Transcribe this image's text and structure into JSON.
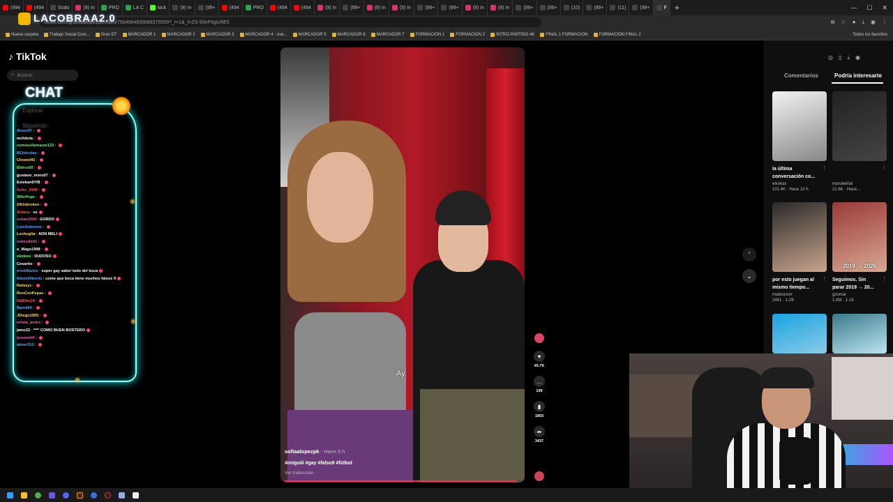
{
  "browser": {
    "tabs": [
      {
        "label": "(494",
        "color": "#ff0000"
      },
      {
        "label": "(494",
        "color": "#ff0000"
      },
      {
        "label": "Sodo",
        "color": "#444444"
      },
      {
        "label": "(9) In",
        "color": "#e1306c"
      },
      {
        "label": "PRO",
        "color": "#2aa44f"
      },
      {
        "label": "LA C",
        "color": "#2aa44f"
      },
      {
        "label": "kick",
        "color": "#53fc18"
      },
      {
        "label": "(9) In",
        "color": "#444444"
      },
      {
        "label": "(99+",
        "color": "#444444"
      },
      {
        "label": "(494",
        "color": "#ff0000"
      },
      {
        "label": "PRO",
        "color": "#2aa44f"
      },
      {
        "label": "(494",
        "color": "#ff0000"
      },
      {
        "label": "(494",
        "color": "#ff0000"
      },
      {
        "label": "(9) In",
        "color": "#e1306c"
      },
      {
        "label": "(99+",
        "color": "#444444"
      },
      {
        "label": "(9) In",
        "color": "#e1306c"
      },
      {
        "label": "(9) In",
        "color": "#e1306c"
      },
      {
        "label": "(99+",
        "color": "#444444"
      },
      {
        "label": "(99+",
        "color": "#444444"
      },
      {
        "label": "(9) In",
        "color": "#e1306c"
      },
      {
        "label": "(9) In",
        "color": "#e1306c"
      },
      {
        "label": "(99+",
        "color": "#444444"
      },
      {
        "label": "(99+",
        "color": "#444444"
      },
      {
        "label": "(10)",
        "color": "#444444"
      },
      {
        "label": "(99+",
        "color": "#444444"
      },
      {
        "label": "(11)",
        "color": "#444444"
      },
      {
        "label": "(99+",
        "color": "#444444"
      },
      {
        "label": "F",
        "color": "#444444",
        "active": true
      }
    ],
    "new_tab": "+",
    "url": "tiktok.com/@sofiaalopezpk/video/7604964935688375559?_r=1&_t=ZS-93nF5gIcRE5",
    "bookmarks": [
      "Nueva carpeta",
      "Trabajo Social Com...",
      "Gran DT",
      "MARCADOR 1",
      "MARCADOR 2",
      "MARCADOR 3",
      "MARCADOR 4 - ove...",
      "MARCADOR 5",
      "MARCADOR 6",
      "MARCADOR 7",
      "FORMACION 1",
      "FORMACION 2",
      "INTRO PARTIDO 4K",
      "FINAL 1 FORMACION",
      "FORMACION FINAL 2"
    ],
    "favorites_label": "Todos los favoritos"
  },
  "overlay": {
    "logo": "LACOBRAA2.0",
    "chat_title": "CHAT"
  },
  "sidebar": {
    "brand": "TikTok",
    "search_placeholder": "Buscar",
    "faded_items": [
      "Explorar",
      "Siguiendo"
    ]
  },
  "chat": {
    "messages": [
      {
        "user": "Alono07",
        "text": "",
        "color": "#55aaff"
      },
      {
        "user": "mchitula",
        "text": "",
        "color": "#ffffff"
      },
      {
        "user": "comosellamaute123",
        "text": "",
        "color": "#66ff66"
      },
      {
        "user": "853nicolas",
        "text": "",
        "color": "#55aaff"
      },
      {
        "user": "Chowel45",
        "text": "",
        "color": "#ffdd55"
      },
      {
        "user": "Eldrss00",
        "text": "",
        "color": "#66ff66"
      },
      {
        "user": "gustavo_moru07",
        "text": "",
        "color": "#ffffff"
      },
      {
        "user": "EstebanDVB",
        "text": "",
        "color": "#ffffff"
      },
      {
        "user": "Ssfer_2008",
        "text": "",
        "color": "#ff5555"
      },
      {
        "user": "SlferPope",
        "text": "",
        "color": "#66ff66"
      },
      {
        "user": "24Unbroken",
        "text": "",
        "color": "#ffdd55"
      },
      {
        "user": "Aldana",
        "text": "ee",
        "color": "#ff5555"
      },
      {
        "user": "sebas2004",
        "text": "GORDO",
        "color": "#ff55aa"
      },
      {
        "user": "LuisGutierrez",
        "text": "",
        "color": "#55aaff"
      },
      {
        "user": "Lechugita",
        "text": "ADN MELI",
        "color": "#ffdd55"
      },
      {
        "user": "sebexddd1",
        "text": "",
        "color": "#ff55aa"
      },
      {
        "user": "o_Mago1998",
        "text": "",
        "color": "#ffffff"
      },
      {
        "user": "okekesi",
        "text": "DUDOSO",
        "color": "#66ff66"
      },
      {
        "user": "Cesarito",
        "text": "",
        "color": "#ffffff"
      },
      {
        "user": "erick6belov",
        "text": "super gay saber todo del boca",
        "color": "#55aaff"
      },
      {
        "user": "frdsickfikonix",
        "text": "como que boca tiene muchos falsos 9",
        "color": "#55aaff"
      },
      {
        "user": "Rafaxyz",
        "text": "",
        "color": "#ffdd55"
      },
      {
        "user": "RonConPepas",
        "text": "",
        "color": "#ffdd55"
      },
      {
        "user": "NaBihu24",
        "text": "",
        "color": "#ff5555"
      },
      {
        "user": "Bamd64",
        "text": "",
        "color": "#55aaff"
      },
      {
        "user": "JDiego1905",
        "text": "",
        "color": "#ffdd55"
      },
      {
        "user": "whola_pedrx",
        "text": "",
        "color": "#ff55aa"
      },
      {
        "user": "jamc22",
        "text": "**** COMO BUEN BOSTERO",
        "color": "#ffffff"
      },
      {
        "user": "jesusmtlll",
        "text": "",
        "color": "#ff55aa"
      },
      {
        "user": "abner312",
        "text": "",
        "color": "#55aaff"
      }
    ]
  },
  "video": {
    "caption_overlay": "Ay,",
    "author": "sofiaalopezpk",
    "age": "Hace 5 h",
    "description": "Amiguiii #gay #falso9 #fútbol",
    "translate": "Ver traducción",
    "progress": 0.98,
    "likes": "45.7K",
    "comments": "199",
    "saves": "1803",
    "shares": "3437"
  },
  "right_panel": {
    "tabs": [
      "Comentarios",
      "Podría interesarte"
    ],
    "active_tab": "Podría interesarte",
    "cards": [
      {
        "title": "la última conversación co...",
        "author": "elxokas",
        "stats": "101.4K · Hace 10 h",
        "thumb_label": "",
        "colors": [
          "#f2f2f2",
          "#888888"
        ]
      },
      {
        "title": "",
        "author": "marulekhal",
        "stats": "21.6K · Hace...",
        "thumb_label": "",
        "colors": [
          "#222222",
          "#444444"
        ]
      },
      {
        "title": "por esto juegan al mismo tiempo...",
        "author": "mateocrorr",
        "stats": "2461 · 1-28",
        "thumb_label": "",
        "colors": [
          "#2a2a2a",
          "#c9a58c"
        ]
      },
      {
        "title": "Seguimos. Sin parar 2019 → 20...",
        "author": "gzomar",
        "stats": "1.9M · 1-16",
        "thumb_label": "2019 → 2026",
        "colors": [
          "#9a3a3a",
          "#d8a890"
        ]
      },
      {
        "title": "",
        "author": "",
        "stats": "",
        "thumb_label": "",
        "colors": [
          "#1aa3e0",
          "#8acbe8"
        ]
      },
      {
        "title": "",
        "author": "",
        "stats": "",
        "thumb_label": "",
        "colors": [
          "#3a7a8a",
          "#bde4f0"
        ]
      }
    ]
  }
}
